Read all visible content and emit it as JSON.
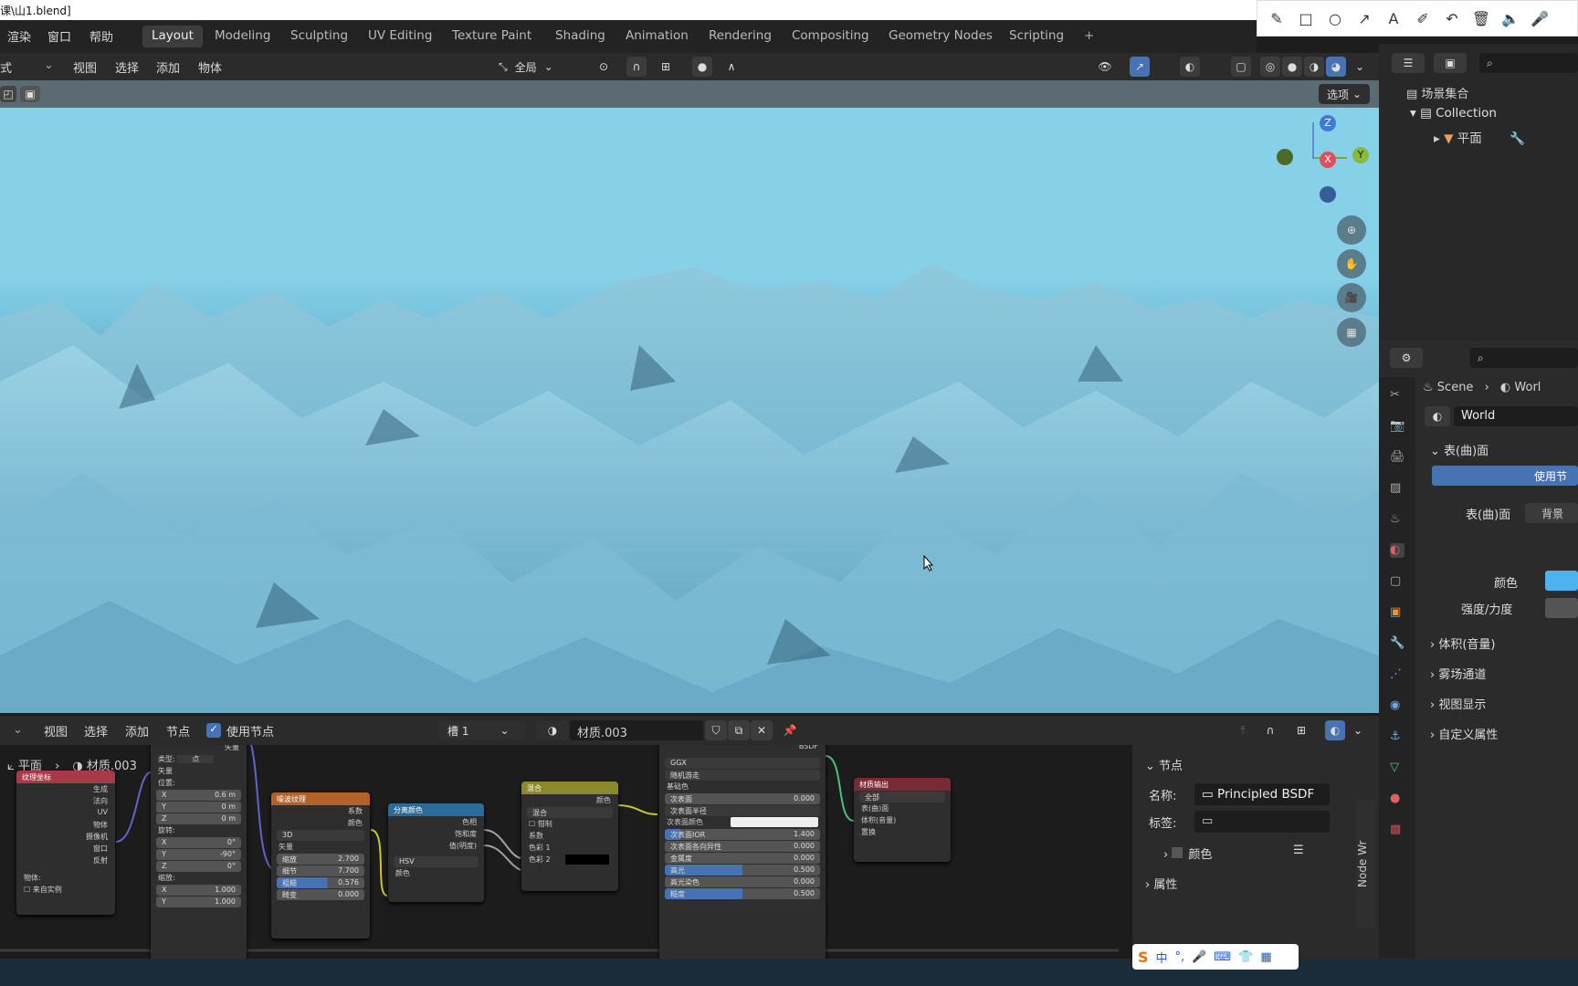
{
  "window": {
    "title": "课\\山1.blend]"
  },
  "annotation_toolbar": {
    "icons": [
      "pencil-icon",
      "rectangle-icon",
      "circle-icon",
      "arrow-icon",
      "text-icon",
      "highlighter-icon",
      "undo-icon",
      "trash-icon",
      "speaker-icon",
      "microphone-icon"
    ]
  },
  "topbar": {
    "menus": [
      "渲染",
      "窗口",
      "帮助"
    ],
    "workspaces": [
      "Layout",
      "Modeling",
      "Sculpting",
      "UV Editing",
      "Texture Paint",
      "Shading",
      "Animation",
      "Rendering",
      "Compositing",
      "Geometry Nodes",
      "Scripting"
    ],
    "active_workspace": "Layout",
    "add_tab": "+"
  },
  "viewport_header": {
    "mode": "式",
    "menus": [
      "视图",
      "选择",
      "添加",
      "物体"
    ],
    "transform_orientation": "全局",
    "options_label": "选项"
  },
  "gizmo": {
    "z": "Z",
    "y": "Y",
    "x": "X"
  },
  "outliner": {
    "scene_collection": "场景集合",
    "collection": "Collection",
    "object": "平面"
  },
  "properties": {
    "breadcrumb_scene": "Scene",
    "breadcrumb_world": "Worl",
    "world_name": "World",
    "panel_surface": "表(曲)面",
    "use_nodes_button": "使用节",
    "surface_label": "表(曲)面",
    "surface_value": "背景",
    "color_label": "颜色",
    "color_value": "#4db3f0",
    "strength_label": "强度/力度",
    "collapsed_panels": [
      "体积(音量)",
      "雾场通道",
      "视图显示",
      "自定义属性"
    ]
  },
  "node_header": {
    "menus": [
      "视图",
      "选择",
      "添加",
      "节点"
    ],
    "use_nodes_label": "使用节点",
    "slot": "槽 1",
    "material": "材质.003",
    "breadcrumb_object": "平面",
    "breadcrumb_material": "材质.003"
  },
  "nodes": {
    "texcoord": {
      "title": "纹理坐标",
      "outputs": [
        "生成",
        "法向",
        "UV",
        "物体",
        "摄像机",
        "窗口",
        "反射"
      ],
      "object_label": "物体:",
      "from_instancer": "来自实例"
    },
    "mapping": {
      "type_label": "类型:",
      "type_value": "点",
      "vector": "矢量",
      "location": "位置:",
      "loc": [
        "0.6 m",
        "0 m",
        "0 m"
      ],
      "rotation": "旋转:",
      "rot": [
        "0°",
        "-90°",
        "0°"
      ],
      "scale": "缩放:",
      "scl": [
        "1.000",
        "1.000"
      ],
      "axes": [
        "X",
        "Y",
        "Z"
      ],
      "top_out": "矢量"
    },
    "noise": {
      "title": "噪波纹理",
      "outputs": [
        "系数",
        "颜色"
      ],
      "dim": "3D",
      "vector": "矢量",
      "fields": [
        [
          "缩放",
          "2.700"
        ],
        [
          "细节",
          "7.700"
        ],
        [
          "粗糙",
          "0.576"
        ],
        [
          "畸变",
          "0.000"
        ]
      ]
    },
    "sephsv": {
      "title": "分离颜色",
      "outputs": [
        "色相",
        "饱和度",
        "值(明度)"
      ],
      "mode": "HSV",
      "input": "颜色"
    },
    "mix": {
      "title": "混合",
      "output": "颜色",
      "blend": "混合",
      "clamp": "钳制",
      "inputs": [
        "系数",
        "色彩 1",
        "色彩 2"
      ]
    },
    "bsdf": {
      "output": "BSDF",
      "dist": "GGX",
      "sss_method": "随机游走",
      "base_color": "基础色",
      "fields": [
        [
          "次表面",
          "0.000"
        ],
        [
          "次表面半径",
          ""
        ],
        [
          "次表面颜色",
          ""
        ],
        [
          "次表面IOR",
          "1.400"
        ],
        [
          "次表面各向异性",
          "0.000"
        ],
        [
          "金属度",
          "0.000"
        ],
        [
          "高光",
          "0.500"
        ],
        [
          "高光染色",
          "0.000"
        ],
        [
          "糙度",
          "0.500"
        ]
      ]
    },
    "output": {
      "title": "材质输出",
      "target": "全部",
      "inputs": [
        "表(曲)面",
        "体积(音量)",
        "置换"
      ]
    }
  },
  "npanel": {
    "node_section": "节点",
    "name_label": "名称:",
    "name_value": "Principled BSDF",
    "label_label": "标签:",
    "color_section": "颜色",
    "properties_section": "属性",
    "side_tab": "Node Wr"
  },
  "ime": {
    "items": [
      "中",
      "°,"
    ]
  }
}
